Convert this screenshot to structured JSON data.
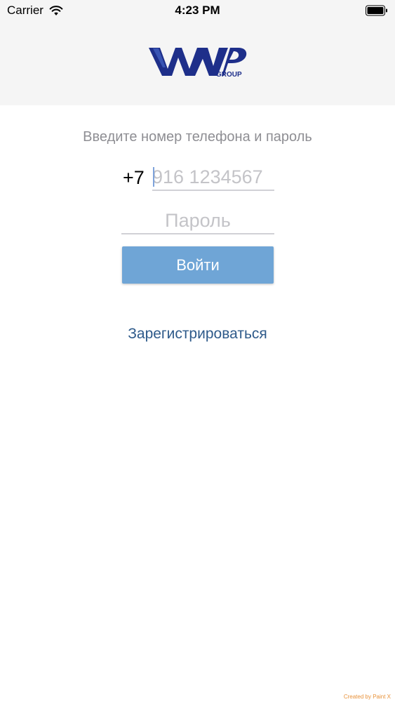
{
  "status_bar": {
    "carrier": "Carrier",
    "time": "4:23 PM",
    "wifi_icon": "wifi-icon",
    "battery_icon": "battery-full-icon"
  },
  "header": {
    "logo_icon": "wvp-group-logo",
    "logo_text": "WVP",
    "logo_subtext": "GROUP",
    "logo_color": "#1e2f8a"
  },
  "form": {
    "prompt": "Введите номер телефона и пароль",
    "phone_prefix": "+7",
    "phone_placeholder": "916 1234567",
    "phone_value": "",
    "password_placeholder": "Пароль",
    "password_value": "",
    "login_label": "Войти",
    "register_label": "Зарегистрироваться"
  },
  "colors": {
    "button_bg": "#6fa5d6",
    "link": "#2e5a8a",
    "header_bg": "#f5f5f5",
    "prompt_text": "#8e8e93"
  },
  "watermark": "Created by Paint X"
}
